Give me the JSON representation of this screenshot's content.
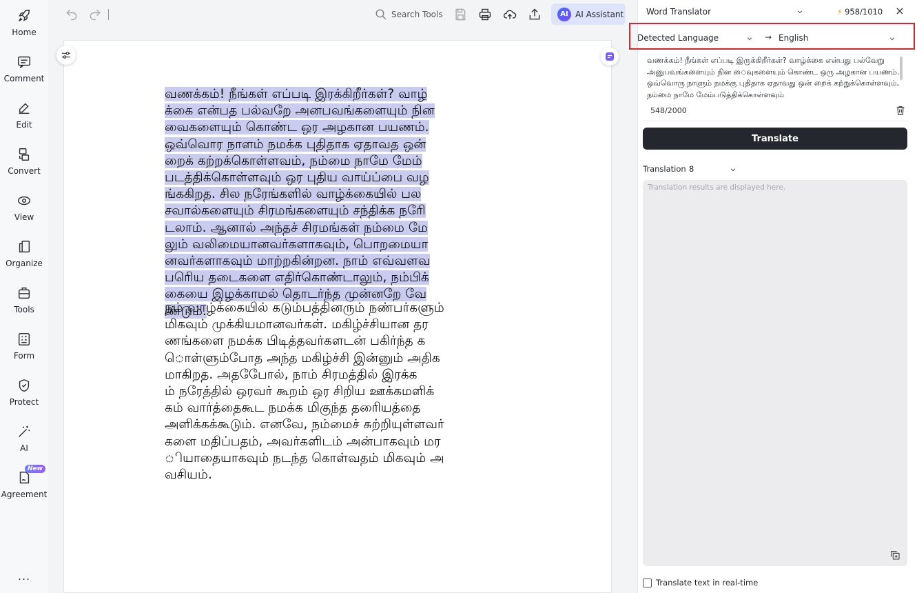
{
  "nav": {
    "items": [
      {
        "label": "Home",
        "icon": "rocket-icon"
      },
      {
        "label": "Comment",
        "icon": "comment-icon"
      },
      {
        "label": "Edit",
        "icon": "edit-icon"
      },
      {
        "label": "Convert",
        "icon": "convert-icon"
      },
      {
        "label": "View",
        "icon": "eye-icon"
      },
      {
        "label": "Organize",
        "icon": "organize-icon"
      },
      {
        "label": "Tools",
        "icon": "toolbox-icon"
      },
      {
        "label": "Form",
        "icon": "form-icon"
      },
      {
        "label": "Protect",
        "icon": "shield-icon"
      },
      {
        "label": "AI",
        "icon": "magic-wand-icon"
      },
      {
        "label": "Agreement",
        "icon": "agreement-icon",
        "badge": "New"
      }
    ],
    "more": "..."
  },
  "toolbar": {
    "search_label": "Search Tools",
    "ai_label": "AI Assistant",
    "ai_logo": "AI"
  },
  "document": {
    "para1_lines": [
      "வணக்கம்! நீங்கள் எப்படி இரக்கிறீர்கள்? வாழ்",
      "க்கை என்பத பல்வறே அனபவங்களையும் நின",
      "வைகளையும் கொண்ட ஒர அழகான பயணம்.",
      "ஒவ்வொர நாளம் நமக்க புதிதாக ஏதாவத ஒன்",
      "றைக் கற்றக்கொள்ளவம், நம்மை நாமே மேம்",
      "படத்திக்கொள்ளவும் ஒர புதிய வாய்ப்பை வழ",
      "ங்ககிறத. சில நரேங்களில் வாழ்க்கையில் பல",
      "சவால்களையும் சிரமங்களையும் சந்திக்க நரேி",
      "டலாம். ஆனால் அந்தச் சிரமங்கள் நம்மை மே",
      "லும் வலிமையானவர்களாகவும், பொறமையா",
      "னவர்களாகவும் மாற்றகின்றன. நாம் எவ்வளவ",
      "பரெிய தடைகளை எதிர்கொண்டாலும், நம்பிக்",
      "கையை இழக்காமல் தொடர்ந்த முன்னறே வே",
      "ண்டும்."
    ],
    "para2_lines": [
      "நம் வாழ்க்கையில் கடும்பத்தினரும் நண்பர்களும்",
      "மிகவும் முக்கியமானவர்கள். மகிழ்ச்சியான தர",
      "ணங்களை நமக்க பிடித்தவர்களடன் பகிர்ந்த க",
      "ொள்ளும்போத அந்த மகிழ்ச்சி இன்னும் அதிக",
      "மாகிறத. அதபேோல், நாம் சிரமத்தில் இரக்க",
      "ம் நரேத்தில் ஒரவர் கூறம் ஒர சிறிய ஊக்கமளிக்",
      "கம் வார்த்தைகூட நமக்க மிகுந்த தரைியத்தை",
      "அளிக்கக்கூடும். எனவே, நம்மைச் சுற்றியுள்ளவர்",
      "களை மதிப்பதம், அவர்களிடம் அன்பாகவும் மர",
      "ியாதையாகவும் நடந்த கொள்வதம் மிகவும் அ",
      "வசியம்."
    ]
  },
  "translator": {
    "title": "Word Translator",
    "credits": "958/1010",
    "source_language": "Detected Language",
    "arrow": "→",
    "target_language": "English",
    "source_text": "வணக்கம்! நீங்கள் எப்படி இருக்கிறீர்கள்? வாழ்க்கை என்பது பல்வேறு அனுபவங்களையும் நின ைவுகளையும் கொண்ட ஒரு அழகான பயணம். ஒவ்வொரு நாளும் நமக்கு புதிதாக ஏதாவது ஒன் றைக் கற்றுக்கொள்ளவும், நம்மை நாமே மேம்படுத்திக்கொள்ளவும்",
    "char_count": "548/2000",
    "translate_button": "Translate",
    "translation_label": "Translation",
    "translation_size": "8",
    "result_placeholder": "Translation results are displayed here.",
    "realtime_label": "Translate text in real-time"
  }
}
